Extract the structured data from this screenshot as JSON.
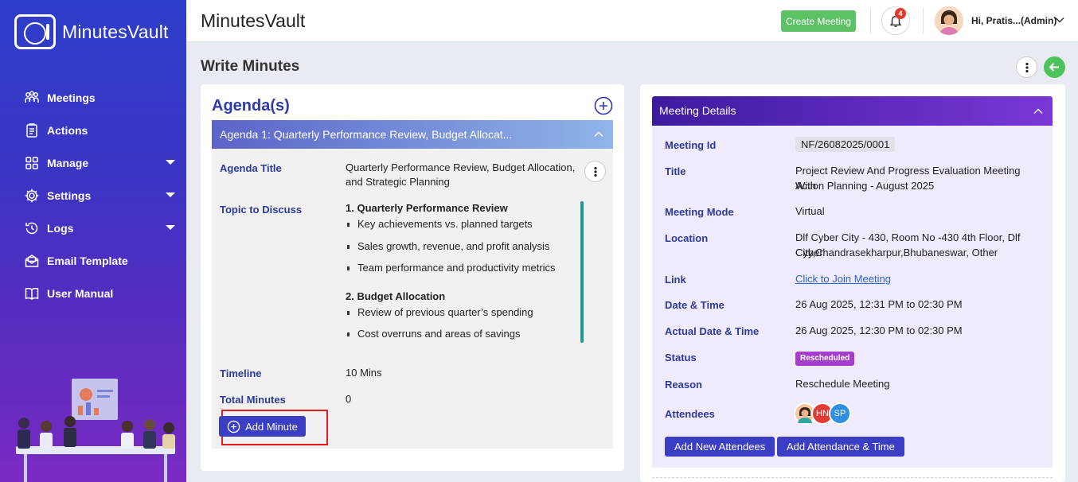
{
  "brand": {
    "name": "MinutesVault"
  },
  "sidebar": {
    "items": [
      {
        "label": "Meetings",
        "icon": "meetings-icon",
        "has_caret": false
      },
      {
        "label": "Actions",
        "icon": "actions-icon",
        "has_caret": false
      },
      {
        "label": "Manage",
        "icon": "manage-icon",
        "has_caret": true
      },
      {
        "label": "Settings",
        "icon": "gear-icon",
        "has_caret": true
      },
      {
        "label": "Logs",
        "icon": "history-icon",
        "has_caret": true
      },
      {
        "label": "Email Template",
        "icon": "email-icon",
        "has_caret": false
      },
      {
        "label": "User Manual",
        "icon": "book-icon",
        "has_caret": false
      }
    ]
  },
  "topbar": {
    "title": "MinutesVault",
    "create_meeting_label": "Create Meeting",
    "notification_count": "4",
    "user_greeting": "Hi, Pratis...(Admin)"
  },
  "page": {
    "title": "Write Minutes"
  },
  "agenda": {
    "heading": "Agenda(s)",
    "bar_title": "Agenda 1: Quarterly Performance Review, Budget Allocat...",
    "labels": {
      "title": "Agenda Title",
      "topic": "Topic to Discuss",
      "timeline": "Timeline",
      "total_minutes": "Total Minutes"
    },
    "title_value_line1": "Quarterly Performance Review, Budget Allocation,",
    "title_value_line2": "and Strategic Planning",
    "topics": [
      {
        "heading": "1. Quarterly Performance Review",
        "points": [
          "Key achievements vs. planned targets",
          "Sales growth, revenue, and profit analysis",
          "Team performance and productivity metrics"
        ]
      },
      {
        "heading": "2. Budget Allocation",
        "points": [
          "Review of previous quarter’s spending",
          "Cost overruns and areas of savings"
        ]
      }
    ],
    "timeline_value": "10 Mins",
    "total_minutes_value": "0",
    "add_minute_label": "Add Minute"
  },
  "meeting_details": {
    "heading": "Meeting Details",
    "labels": {
      "meeting_id": "Meeting Id",
      "title": "Title",
      "mode": "Meeting Mode",
      "location": "Location",
      "link": "Link",
      "date_time": "Date & Time",
      "actual_date_time": "Actual Date & Time",
      "status": "Status",
      "reason": "Reason",
      "attendees": "Attendees"
    },
    "meeting_id": "NF/26082025/0001",
    "title_line1": "Project Review And Progress Evaluation Meeting With",
    "title_line2": "Action Planning - August 2025",
    "mode": "Virtual",
    "location_line1": "Dlf Cyber City - 430, Room No -430 4th Floor, Dlf Cyber",
    "location_line2": "City,Chandrasekharpur,Bhubaneswar, Other",
    "link_text": "Click to Join Meeting",
    "date_time": "26 Aug 2025, 12:31 PM to 02:30 PM",
    "actual_date_time": "26 Aug 2025, 12:30 PM to 02:30 PM",
    "status": "Rescheduled",
    "reason": "Reschedule Meeting",
    "attendees": [
      {
        "initials": "",
        "color": "#f2c8a6"
      },
      {
        "initials": "HN",
        "color": "#e23b34"
      },
      {
        "initials": "SP",
        "color": "#2f8fe0"
      }
    ],
    "add_new_attendees_label": "Add New Attendees",
    "add_attendance_label": "Add Attendance & Time"
  },
  "colors": {
    "sidebar_gradient_top": "#2d3ec8",
    "sidebar_gradient_bottom": "#7a2bc3",
    "create_button": "#5dc265",
    "primary_button": "#3a3ec5",
    "status_rescheduled": "#a43ecb",
    "highlight_frame": "#e0201e"
  }
}
